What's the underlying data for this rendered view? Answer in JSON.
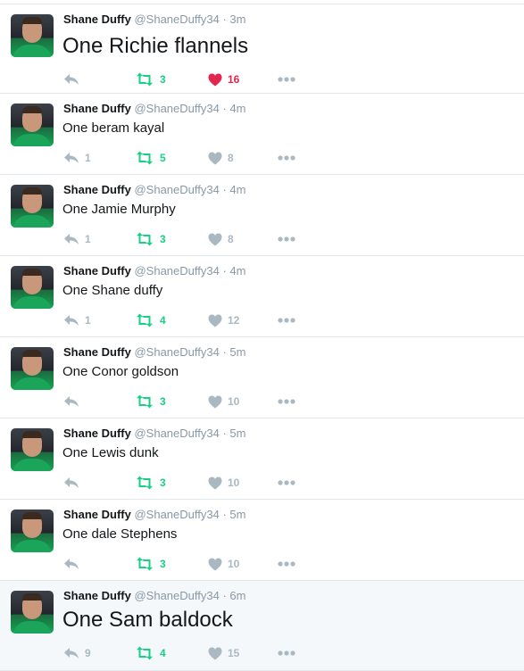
{
  "colors": {
    "retweet": "#19cf86",
    "liked": "#e2264d",
    "muted": "#aab8c2",
    "handle": "#8899a6"
  },
  "icons": {
    "reply": "reply-icon",
    "retweet": "retweet-icon",
    "like": "heart-icon",
    "more": "more-icon"
  },
  "tweets": [
    {
      "name": "Shane Duffy",
      "handle": "@ShaneDuffy34",
      "dot": "·",
      "time": "3m",
      "text": "One Richie flannels",
      "replies": "",
      "retweets": "3",
      "likes": "16",
      "liked": true
    },
    {
      "name": "Shane Duffy",
      "handle": "@ShaneDuffy34",
      "dot": "·",
      "time": "4m",
      "text": "One beram kayal",
      "replies": "1",
      "retweets": "5",
      "likes": "8",
      "liked": false
    },
    {
      "name": "Shane Duffy",
      "handle": "@ShaneDuffy34",
      "dot": "·",
      "time": "4m",
      "text": "One Jamie Murphy",
      "replies": "1",
      "retweets": "3",
      "likes": "8",
      "liked": false
    },
    {
      "name": "Shane Duffy",
      "handle": "@ShaneDuffy34",
      "dot": "·",
      "time": "4m",
      "text": "One Shane duffy",
      "replies": "1",
      "retweets": "4",
      "likes": "12",
      "liked": false
    },
    {
      "name": "Shane Duffy",
      "handle": "@ShaneDuffy34",
      "dot": "·",
      "time": "5m",
      "text": "One Conor goldson",
      "replies": "",
      "retweets": "3",
      "likes": "10",
      "liked": false
    },
    {
      "name": "Shane Duffy",
      "handle": "@ShaneDuffy34",
      "dot": "·",
      "time": "5m",
      "text": "One Lewis dunk",
      "replies": "",
      "retweets": "3",
      "likes": "10",
      "liked": false
    },
    {
      "name": "Shane Duffy",
      "handle": "@ShaneDuffy34",
      "dot": "·",
      "time": "5m",
      "text": "One dale Stephens",
      "replies": "",
      "retweets": "3",
      "likes": "10",
      "liked": false
    },
    {
      "name": "Shane Duffy",
      "handle": "@ShaneDuffy34",
      "dot": "·",
      "time": "6m",
      "text": "One Sam baldock",
      "replies": "9",
      "retweets": "4",
      "likes": "15",
      "liked": false
    }
  ]
}
